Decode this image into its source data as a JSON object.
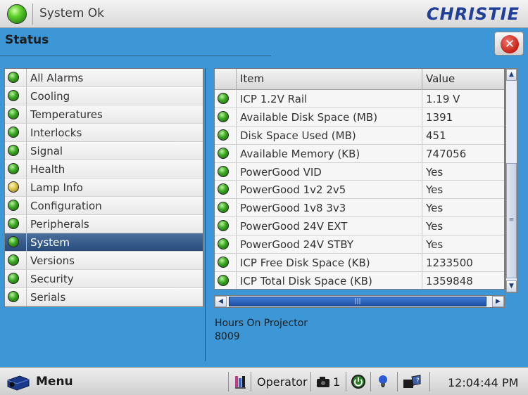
{
  "topbar": {
    "status_text": "System Ok",
    "logo_text": "CHRISTIE",
    "logo_color": "#1f3f98"
  },
  "status": {
    "title": "Status"
  },
  "nav": {
    "items": [
      {
        "label": "All Alarms",
        "led": "green"
      },
      {
        "label": "Cooling",
        "led": "green"
      },
      {
        "label": "Temperatures",
        "led": "green"
      },
      {
        "label": "Interlocks",
        "led": "green"
      },
      {
        "label": "Signal",
        "led": "green"
      },
      {
        "label": "Health",
        "led": "green"
      },
      {
        "label": "Lamp Info",
        "led": "yellow"
      },
      {
        "label": "Configuration",
        "led": "green"
      },
      {
        "label": "Peripherals",
        "led": "green"
      },
      {
        "label": "System",
        "led": "green",
        "selected": true
      },
      {
        "label": "Versions",
        "led": "green"
      },
      {
        "label": "Security",
        "led": "green"
      },
      {
        "label": "Serials",
        "led": "green"
      }
    ]
  },
  "table": {
    "headers": {
      "item": "Item",
      "value": "Value"
    },
    "rows": [
      {
        "item": "ICP 1.2V Rail",
        "value": "1.19 V"
      },
      {
        "item": "Available Disk Space (MB)",
        "value": "1391"
      },
      {
        "item": "Disk Space Used (MB)",
        "value": "451"
      },
      {
        "item": "Available Memory (KB)",
        "value": "747056"
      },
      {
        "item": "PowerGood VID",
        "value": "Yes"
      },
      {
        "item": "PowerGood 1v2 2v5",
        "value": "Yes"
      },
      {
        "item": "PowerGood 1v8 3v3",
        "value": "Yes"
      },
      {
        "item": "PowerGood 24V EXT",
        "value": "Yes"
      },
      {
        "item": "PowerGood 24V STBY",
        "value": "Yes"
      },
      {
        "item": "ICP Free Disk Space (KB)",
        "value": "1233500"
      },
      {
        "item": "ICP Total Disk Space (KB)",
        "value": "1359848"
      }
    ]
  },
  "hours": {
    "label": "Hours On Projector",
    "value": "8009"
  },
  "bottombar": {
    "menu_label": "Menu",
    "user_label": "Operator",
    "count_label": "1",
    "time": "12:04:44 PM"
  },
  "icons": {
    "status_led": "green-led-icon",
    "close": "close-icon",
    "menu": "projector-icon",
    "user": "user-icon",
    "count": "camera-icon",
    "power": "power-icon",
    "info": "lightbulb-icon",
    "help": "help-icon"
  },
  "colors": {
    "background": "#3d97d6",
    "selected_row": "#274c7d",
    "led_green": "#3aa620",
    "led_yellow": "#d8c64a",
    "close_red": "#c42016"
  }
}
